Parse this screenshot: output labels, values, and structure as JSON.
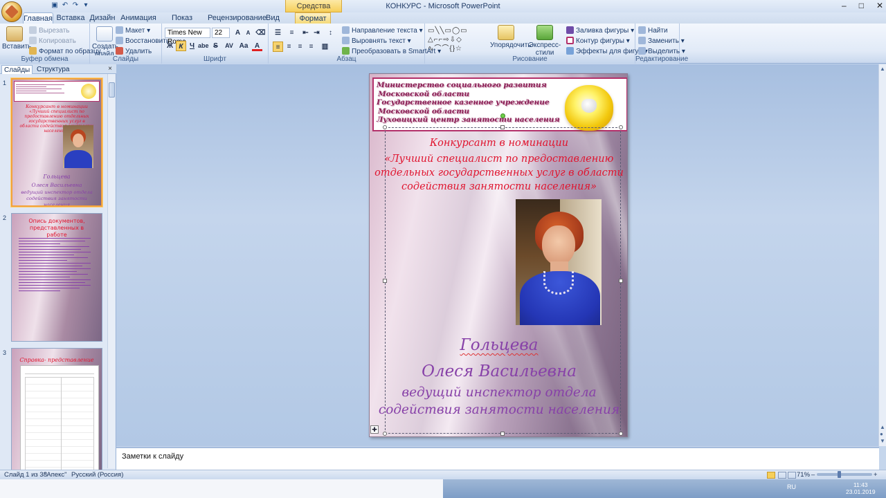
{
  "window": {
    "title": "КОНКУРС - Microsoft PowerPoint",
    "context_tab": "Средства рисования",
    "min": "–",
    "max": "□",
    "close": "✕"
  },
  "tabs": [
    "Главная",
    "Вставка",
    "Дизайн",
    "Анимация",
    "Показ слайдов",
    "Рецензирование",
    "Вид",
    "Формат"
  ],
  "ribbon": {
    "clipboard": {
      "paste": "Вставить",
      "cut": "Вырезать",
      "copy": "Копировать",
      "format_painter": "Формат по образцу",
      "label": "Буфер обмена"
    },
    "slides": {
      "new_slide": "Создать слайд",
      "layout": "Макет",
      "reset": "Восстановить",
      "delete": "Удалить",
      "label": "Слайды"
    },
    "font": {
      "font_name": "Times New Roma",
      "font_size": "22",
      "label": "Шрифт",
      "bold": "Ж",
      "italic": "К",
      "underline": "Ч",
      "shadow": "abe",
      "strike": "S",
      "spacing": "AV",
      "case": "Aa",
      "color": "A",
      "grow": "A",
      "shrink": "A"
    },
    "paragraph": {
      "direction": "Направление текста",
      "align": "Выровнять текст",
      "smartart": "Преобразовать в SmartArt",
      "label": "Абзац"
    },
    "drawing": {
      "arrange": "Упорядочить",
      "quick_styles": "Экспресс-стили",
      "fill": "Заливка фигуры",
      "outline": "Контур фигуры",
      "effects": "Эффекты для фигур",
      "label": "Рисование"
    },
    "editing": {
      "find": "Найти",
      "replace": "Заменить",
      "select": "Выделить",
      "label": "Редактирование"
    }
  },
  "pane": {
    "tab_slides": "Слайды",
    "tab_outline": "Структура",
    "close": "×",
    "thumbs": [
      {
        "num": "1",
        "title": "Конкурсант в номинации",
        "sub": "«Лучший специалист по предоставлению отдельных государственных услуг в области содействия занятости населения»",
        "name1": "Гольцева",
        "name2": "Олеся Васильевна",
        "role": "ведущий инспектор отдела содействия занятости населения"
      },
      {
        "num": "2",
        "title": "Опись документов, представленных в работе"
      },
      {
        "num": "3",
        "title": "Справка- представление"
      }
    ]
  },
  "slide": {
    "header_lines": [
      "Министерство социального развития",
      "Московской области",
      "Государственное казенное учреждение",
      "Московской области",
      "Луховицкий центр занятости населения"
    ],
    "nomination": [
      "Конкурсант в номинации",
      "«Лучший специалист по предоставлению",
      "отдельных государственных услуг в области",
      "содействия занятости населения»"
    ],
    "surname": "Гольцева",
    "given_names": "Олеся Васильевна",
    "role": [
      "ведущий инспектор отдела",
      "содействия занятости населения"
    ],
    "anchor_icon": "✚"
  },
  "notes_placeholder": "Заметки к слайду",
  "status": {
    "slide_info": "Слайд 1 из 38",
    "theme": "\"Апекс\"",
    "language": "Русский (Россия)",
    "zoom": "71%",
    "zoom_minus": "–",
    "zoom_plus": "+"
  },
  "taskbar": {
    "lang": "RU",
    "time": "11:43",
    "date": "23.01.2019"
  },
  "colors": {
    "header_text": "#8a1f55",
    "nomination": "#e0142e",
    "name": "#8741a8"
  }
}
